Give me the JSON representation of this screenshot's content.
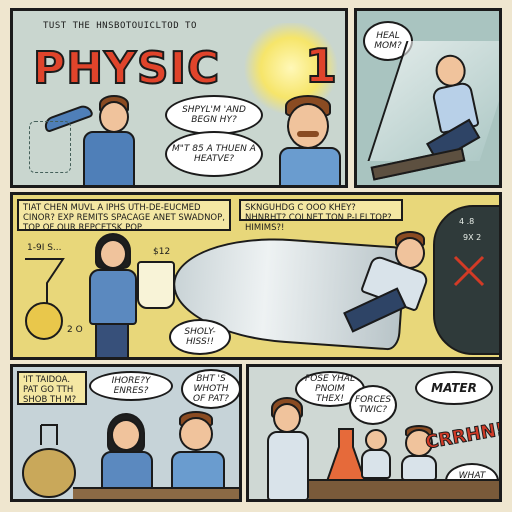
{
  "title": {
    "kicker": "TUST THE HNSBOTOUICLTOD TO",
    "word": "PHYSIC",
    "number": "1"
  },
  "panel1": {
    "bubble_a": "SHPYL'M 'AND BEGN HY?",
    "bubble_b": "M\"T 85 A THUEN A HEATVE?"
  },
  "panel2": {
    "bubble": "HEAL MOM?"
  },
  "panel3": {
    "caption_left": "TIAT CHEN MUVL A IPHS UTH-DE-EUCMED CINOR? EXP REMITS SPACAGE ANET SWADNOP, TOP OF OUR REPCETSK POP.",
    "caption_right": "SKNGUHDG C OOO KHEY? NHNRHT? COLNET TON P-LEI TOP? HIMIMS?!",
    "note_left": "1-9I S...",
    "note_mid": "$12",
    "note_flask": "2 O",
    "bubble_hiss": "SHOLY- HISS!!",
    "board_a": "4 .8",
    "board_b": "9X 2"
  },
  "panel4": {
    "caption": "'IT TAIDOA. PAT GO TTH SHOB TH M?",
    "bubble_a": "IHORE?Y ENRES?",
    "bubble_b": "BHT 'S WHOTH OF PAT?"
  },
  "panel5": {
    "bubble_a": "FOSE YHAL PNOIM THEX!",
    "bubble_b": "FORCES TWIC?",
    "bubble_c": "MATER",
    "bubble_d": "WHAT YOSU?",
    "sfx": "CRRHN!!"
  }
}
